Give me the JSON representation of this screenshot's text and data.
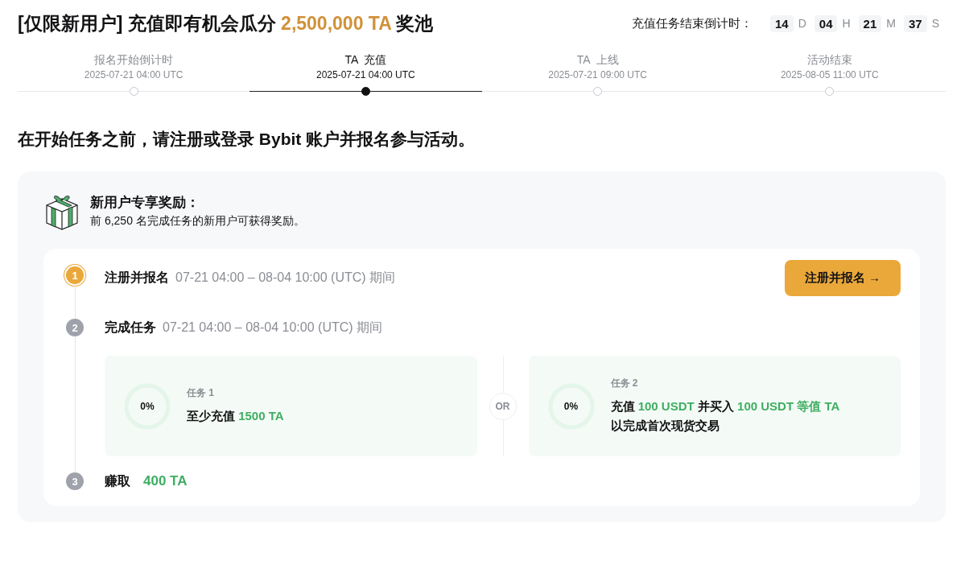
{
  "title": [
    {
      "text": "[仅限新用户] 充值即有机会瓜分 ",
      "highlight": false
    },
    {
      "text": "2,500,000 TA",
      "highlight": true
    },
    {
      "text": " 奖池",
      "highlight": false
    }
  ],
  "countdown": {
    "label": "充值任务结束倒计时：",
    "units": [
      {
        "value": "14",
        "unit": "D"
      },
      {
        "value": "04",
        "unit": "H"
      },
      {
        "value": "21",
        "unit": "M"
      },
      {
        "value": "37",
        "unit": "S"
      }
    ]
  },
  "timeline": [
    {
      "label": "报名开始倒计时",
      "time": "2025-07-21 04:00 UTC",
      "selected": false
    },
    {
      "label": "TA  充值",
      "time": "2025-07-21 04:00 UTC",
      "selected": true
    },
    {
      "label": "TA  上线",
      "time": "2025-07-21 09:00 UTC",
      "selected": false
    },
    {
      "label": "活动结束",
      "time": "2025-08-05 11:00 UTC",
      "selected": false
    }
  ],
  "heading": "在开始任务之前，请注册或登录 Bybit 账户并报名参与活动。",
  "reward": {
    "title": "新用户专享奖励：",
    "subtitle": "前 6,250 名完成任务的新用户可获得奖励。"
  },
  "steps": [
    {
      "kind": "period",
      "number": "1",
      "active": true,
      "title": "注册并报名",
      "period": "07-21 04:00 – 08-04 10:00 (UTC) 期间",
      "button": "注册并报名 →"
    },
    {
      "kind": "tasks",
      "number": "2",
      "active": false,
      "title": "完成任务",
      "period": "07-21 04:00 – 08-04 10:00 (UTC) 期间",
      "tasks": [
        {
          "label": "任务 1",
          "progress": "0%",
          "level": 0,
          "lines": [
            [
              {
                "text": "至少充值 ",
                "highlight": false
              },
              {
                "text": "1500 TA",
                "highlight": true
              }
            ]
          ]
        },
        {
          "label": "任务 2",
          "progress": "0%",
          "level": 0,
          "lines": [
            [
              {
                "text": "充值 ",
                "highlight": false
              },
              {
                "text": "100 USDT",
                "highlight": true
              },
              {
                "text": " 并买入 ",
                "highlight": false
              },
              {
                "text": "100 USDT 等值 TA",
                "highlight": true
              }
            ],
            [
              {
                "text": "以完成首次现货交易",
                "highlight": false
              }
            ]
          ]
        }
      ],
      "separator": "OR"
    },
    {
      "kind": "reward",
      "number": "3",
      "active": false,
      "title": "赚取",
      "reward": "400 TA"
    }
  ]
}
